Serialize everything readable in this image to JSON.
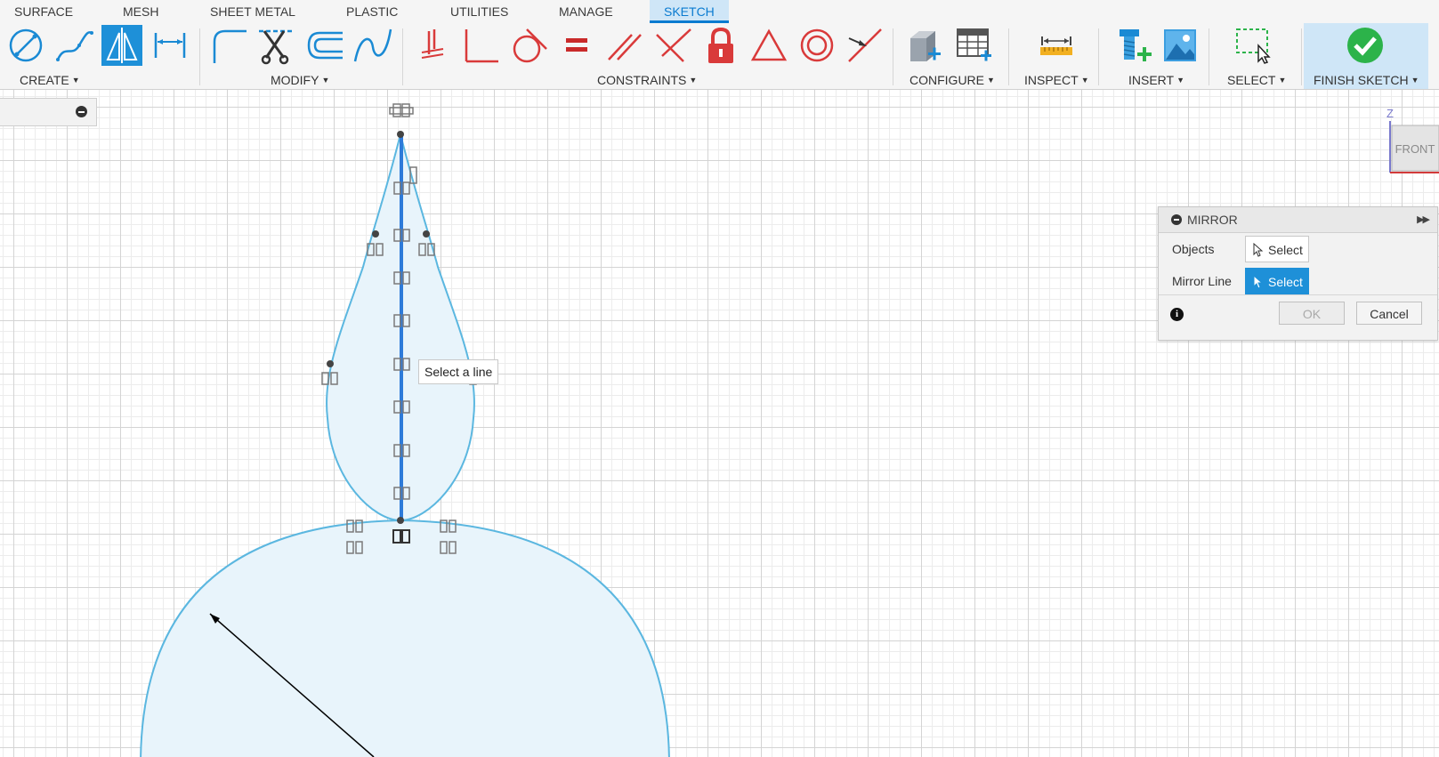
{
  "tabs": [
    "SURFACE",
    "MESH",
    "SHEET METAL",
    "PLASTIC",
    "UTILITIES",
    "MANAGE",
    "SKETCH"
  ],
  "active_tab": "SKETCH",
  "ribbon": {
    "groups": {
      "create": "CREATE",
      "modify": "MODIFY",
      "constraints": "CONSTRAINTS",
      "configure": "CONFIGURE",
      "inspect": "INSPECT",
      "insert": "INSERT",
      "select": "SELECT",
      "finish": "FINISH SKETCH"
    },
    "tools": {
      "create": [
        "line-icon",
        "spline-icon",
        "mirror-icon",
        "sketch-dimension-icon"
      ],
      "modify": [
        "fillet-icon",
        "trim-icon",
        "offset-icon",
        "fit-point-spline-icon"
      ],
      "constraints": [
        "coincident-icon",
        "perpendicular-icon",
        "tangent-icon",
        "equal-icon",
        "parallel-icon",
        "collinear-icon",
        "fix-icon",
        "triangle-icon",
        "concentric-icon",
        "midpoint-icon"
      ],
      "configure": [
        "configure-model-icon",
        "parameters-table-icon"
      ],
      "inspect": [
        "measure-icon"
      ],
      "insert": [
        "insert-mcmaster-icon",
        "insert-canvas-icon"
      ],
      "select": [
        "window-select-icon"
      ],
      "finish": [
        "check-icon"
      ]
    },
    "active_tool": "mirror-icon"
  },
  "canvas": {
    "tooltip": "Select a line"
  },
  "viewcube": {
    "face": "FRONT",
    "axis": "Z"
  },
  "mirror_dialog": {
    "title": "MIRROR",
    "objects_label": "Objects",
    "objects_button": "Select",
    "mirror_line_label": "Mirror Line",
    "mirror_line_button": "Select",
    "ok": "OK",
    "cancel": "Cancel",
    "info": "i"
  },
  "colors": {
    "accent": "#1e90d8",
    "sketch_line": "#5bb7e0",
    "sketch_fill": "#e8f4fb",
    "selected_line": "#2e7bd9",
    "finish_check": "#2cb34a",
    "constraint_red": "#d93a3a"
  }
}
